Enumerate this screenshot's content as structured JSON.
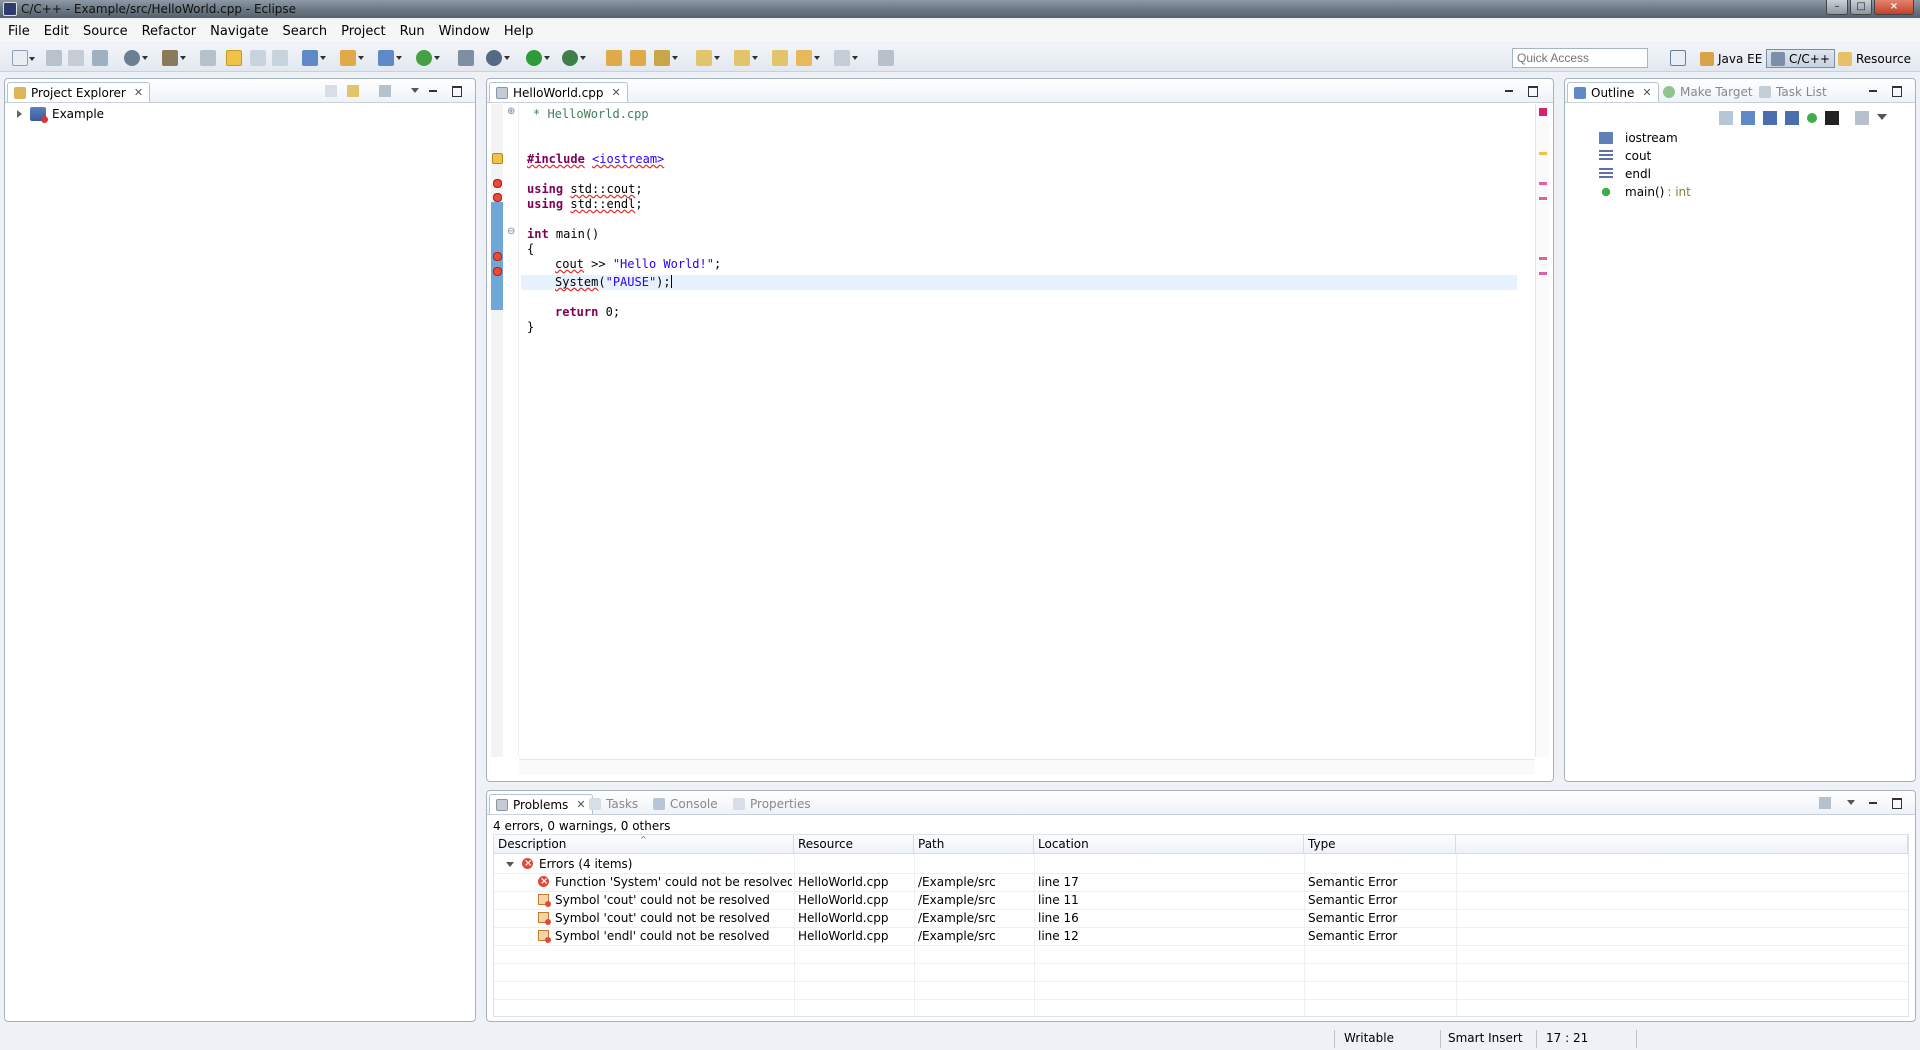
{
  "window": {
    "title": "C/C++ - Example/src/HelloWorld.cpp - Eclipse"
  },
  "menu": [
    "File",
    "Edit",
    "Source",
    "Refactor",
    "Navigate",
    "Search",
    "Project",
    "Run",
    "Window",
    "Help"
  ],
  "toolbar": {
    "quick_access_placeholder": "Quick Access"
  },
  "perspectives": [
    {
      "label": "Java EE",
      "active": false
    },
    {
      "label": "C/C++",
      "active": true
    },
    {
      "label": "Resource",
      "active": false
    }
  ],
  "project_explorer": {
    "tab_label": "Project Explorer",
    "items": [
      {
        "label": "Example"
      }
    ]
  },
  "editor": {
    "tab_label": "HelloWorld.cpp",
    "lines": {
      "comment": "* HelloWorld.cpp",
      "include_kw": "#include",
      "include_file": "<iostream>",
      "using_kw": "using",
      "using1": "std::cout",
      "using2": "std::endl",
      "int_kw": "int",
      "main_sig": "main()",
      "open_brace": "{",
      "cout_id": "cout",
      "cout_op": ">>",
      "cout_str": "\"Hello World!\"",
      "system_id": "System",
      "system_str": "\"PAUSE\"",
      "return_kw": "return",
      "return_val": "0",
      "semicolon": ";",
      "paren_open": "(",
      "paren_close": ")",
      "close_brace": "}"
    }
  },
  "outline": {
    "tabs": [
      "Outline",
      "Make Target",
      "Task List"
    ],
    "items": [
      {
        "label": "iostream",
        "type": ""
      },
      {
        "label": "cout",
        "type": ""
      },
      {
        "label": "endl",
        "type": ""
      },
      {
        "label": "main()",
        "type": ": int"
      }
    ]
  },
  "problems": {
    "tabs": [
      "Problems",
      "Tasks",
      "Console",
      "Properties"
    ],
    "summary": "4 errors, 0 warnings, 0 others",
    "columns": [
      "Description",
      "Resource",
      "Path",
      "Location",
      "Type"
    ],
    "group_label": "Errors (4 items)",
    "rows": [
      {
        "description": "Function 'System' could not be resolved",
        "resource": "HelloWorld.cpp",
        "path": "/Example/src",
        "location": "line 17",
        "type": "Semantic Error"
      },
      {
        "description": "Symbol 'cout' could not be resolved",
        "resource": "HelloWorld.cpp",
        "path": "/Example/src",
        "location": "line 11",
        "type": "Semantic Error"
      },
      {
        "description": "Symbol 'cout' could not be resolved",
        "resource": "HelloWorld.cpp",
        "path": "/Example/src",
        "location": "line 16",
        "type": "Semantic Error"
      },
      {
        "description": "Symbol 'endl' could not be resolved",
        "resource": "HelloWorld.cpp",
        "path": "/Example/src",
        "location": "line 12",
        "type": "Semantic Error"
      }
    ]
  },
  "status": {
    "writable": "Writable",
    "insert_mode": "Smart Insert",
    "position": "17 : 21"
  },
  "colors": {
    "accent": "#6fa7d6",
    "error": "#e04a3a",
    "keyword": "#7f0055",
    "string": "#2a00ff",
    "comment": "#3f7f5f"
  }
}
